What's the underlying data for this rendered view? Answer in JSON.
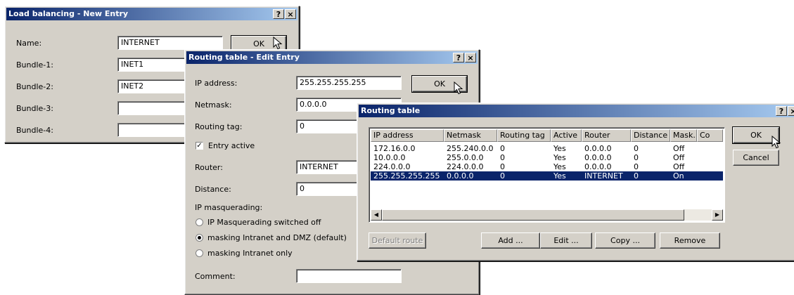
{
  "lb_dialog": {
    "title": "Load balancing - New Entry",
    "help_btn": "?",
    "close_btn": "×",
    "name_label": "Name:",
    "name_value": "INTERNET",
    "bundle1_label": "Bundle-1:",
    "bundle1_value": "INET1",
    "bundle2_label": "Bundle-2:",
    "bundle2_value": "INET2",
    "bundle3_label": "Bundle-3:",
    "bundle3_value": "",
    "bundle4_label": "Bundle-4:",
    "bundle4_value": "",
    "ok_label": "OK"
  },
  "rt_edit": {
    "title": "Routing table - Edit Entry",
    "help_btn": "?",
    "close_btn": "×",
    "ip_label": "IP address:",
    "ip_value": "255.255.255.255",
    "netmask_label": "Netmask:",
    "netmask_value": "0.0.0.0",
    "tag_label": "Routing tag:",
    "tag_value": "0",
    "entry_active_label": "Entry active",
    "entry_active_checked": true,
    "router_label": "Router:",
    "router_value": "INTERNET",
    "distance_label": "Distance:",
    "distance_value": "0",
    "masq_label": "IP masquerading:",
    "masq_options": [
      "IP Masquerading switched off",
      "masking Intranet and DMZ (default)",
      "masking Intranet only"
    ],
    "masq_selected": 1,
    "comment_label": "Comment:",
    "comment_value": "",
    "ok_label": "OK"
  },
  "rt_table": {
    "title": "Routing table",
    "help_btn": "?",
    "close_btn": "×",
    "columns": [
      "IP address",
      "Netmask",
      "Routing tag",
      "Active",
      "Router",
      "Distance",
      "Mask.",
      "Co"
    ],
    "rows": [
      [
        "172.16.0.0",
        "255.240.0.0",
        "0",
        "Yes",
        "0.0.0.0",
        "0",
        "Off"
      ],
      [
        "10.0.0.0",
        "255.0.0.0",
        "0",
        "Yes",
        "0.0.0.0",
        "0",
        "Off"
      ],
      [
        "224.0.0.0",
        "224.0.0.0",
        "0",
        "Yes",
        "0.0.0.0",
        "0",
        "Off"
      ],
      [
        "255.255.255.255",
        "0.0.0.0",
        "0",
        "Yes",
        "INTERNET",
        "0",
        "On"
      ]
    ],
    "selected_row": 3,
    "default_route_label": "Default route",
    "add_label": "Add ...",
    "edit_label": "Edit ...",
    "copy_label": "Copy ...",
    "remove_label": "Remove",
    "ok_label": "OK",
    "cancel_label": "Cancel"
  }
}
